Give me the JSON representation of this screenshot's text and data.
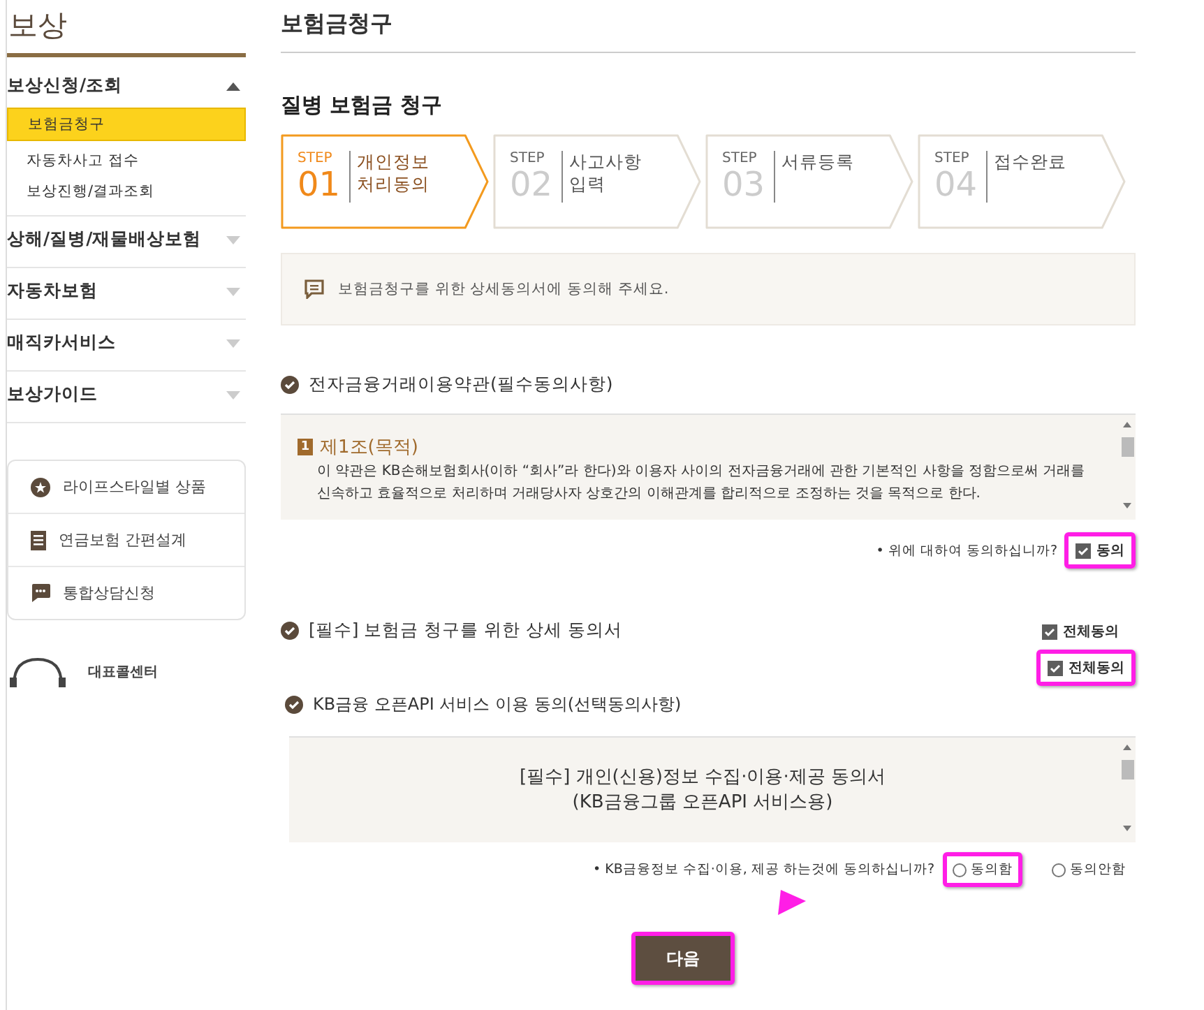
{
  "sidebar": {
    "title": "보상",
    "groups": [
      {
        "label": "보상신청/조회",
        "expanded": true,
        "items": [
          {
            "label": "보험금청구",
            "selected": true
          },
          {
            "label": "자동차사고 접수",
            "selected": false
          },
          {
            "label": "보상진행/결과조회",
            "selected": false
          }
        ]
      },
      {
        "label": "상해/질병/재물배상보험",
        "expanded": false
      },
      {
        "label": "자동차보험",
        "expanded": false
      },
      {
        "label": "매직카서비스",
        "expanded": false
      },
      {
        "label": "보상가이드",
        "expanded": false
      }
    ],
    "quick_links": [
      {
        "kind": "star",
        "label": "라이프스타일별 상품"
      },
      {
        "kind": "doc",
        "label": "연금보험 간편설계"
      },
      {
        "kind": "chat",
        "label": "통합상담신청"
      }
    ],
    "call_center": "대표콜센터"
  },
  "page_title": "보험금청구",
  "section_title": "질병 보험금 청구",
  "steps": [
    {
      "step": "STEP",
      "number": "01",
      "label": "개인정보\n처리동의",
      "selected": true
    },
    {
      "step": "STEP",
      "number": "02",
      "label": "사고사항\n입력",
      "selected": false
    },
    {
      "step": "STEP",
      "number": "03",
      "label": "서류등록",
      "selected": false
    },
    {
      "step": "STEP",
      "number": "04",
      "label": "접수완료",
      "selected": false
    }
  ],
  "notice": "보험금청구를 위한 상세동의서에 동의해 주세요.",
  "terms": {
    "title": "전자금융거래이용약관(필수동의사항)",
    "article_no": "1",
    "article_title": "제1조(목적)",
    "article_body": "이 약관은 KB손해보험회사(이하 “회사”라 한다)와 이용자 사이의 전자금융거래에 관한 기본적인 사항을 정함으로써 거래를 신속하고 효율적으로 처리하며 거래당사자 상호간의 이해관계를 합리적으로 조정하는 것을 목적으로 한다.",
    "question": "• 위에 대하여 동의하십니까?",
    "checkbox": {
      "label": "동의",
      "checked": true,
      "highlighted": true
    }
  },
  "detail": {
    "title": "[필수] 보험금 청구를 위한 상세 동의서",
    "checkboxes": [
      {
        "label": "전체동의",
        "checked": true,
        "highlighted": false
      },
      {
        "label": "전체동의",
        "checked": true,
        "highlighted": true
      }
    ]
  },
  "openapi": {
    "title": "KB금융 오픈API 서비스 이용 동의(선택동의사항)",
    "doc_title": "[필수] 개인(신용)정보 수집·이용·제공 동의서",
    "doc_subtitle": "(KB금융그룹 오픈API 서비스용)",
    "question": "• KB금융정보 수집·이용, 제공 하는것에 동의하십니까?",
    "radios": [
      {
        "label": "동의함",
        "selected": false,
        "highlighted": true
      },
      {
        "label": "동의안함",
        "selected": false,
        "highlighted": false
      }
    ]
  },
  "next_button": {
    "label": "다음",
    "highlighted": true
  }
}
